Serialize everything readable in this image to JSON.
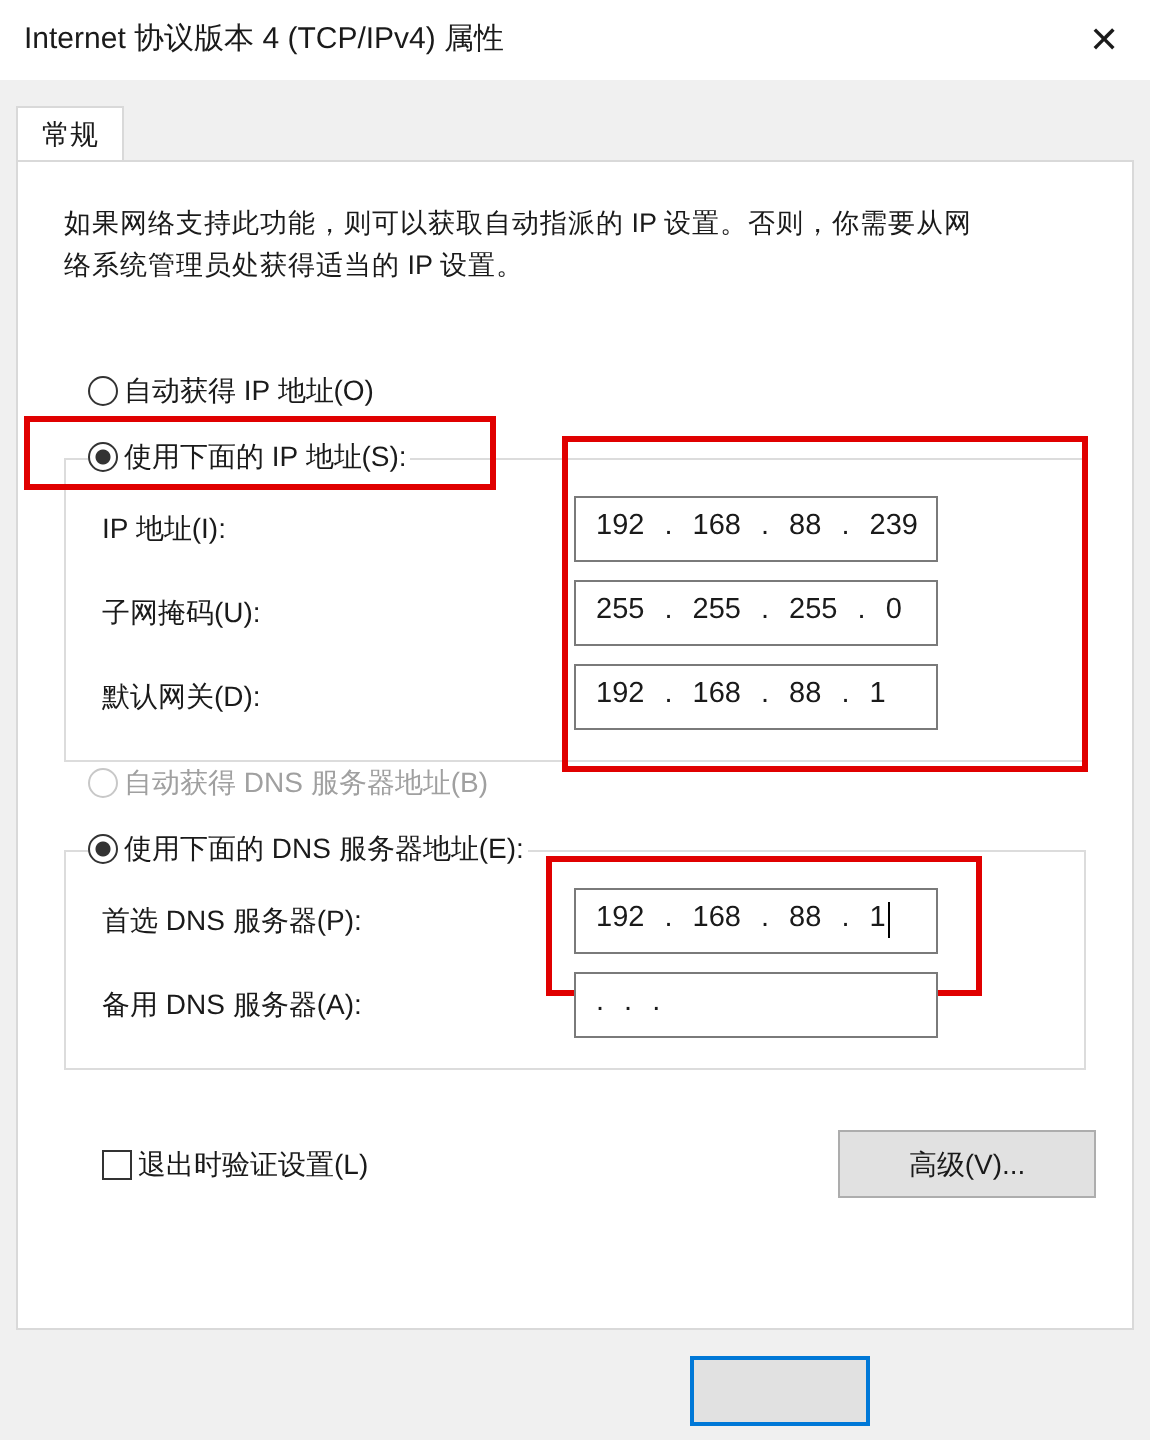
{
  "window": {
    "title": "Internet 协议版本 4 (TCP/IPv4) 属性",
    "close": "✕"
  },
  "tabs": [
    {
      "label": "常规",
      "selected": true
    }
  ],
  "description": "如果网络支持此功能，则可以获取自动指派的 IP 设置。否则，你需要从网络系统管理员处获得适当的 IP 设置。",
  "ip_options": [
    {
      "label": "自动获得 IP 地址(O)",
      "selected": false,
      "disabled": false
    },
    {
      "label": "使用下面的 IP 地址(S):",
      "selected": true,
      "disabled": false,
      "highlighted": true
    }
  ],
  "ip_fields": {
    "highlighted": true,
    "rows": [
      {
        "label": "IP 地址(I):",
        "value": "192 . 168 . 88 . 239"
      },
      {
        "label": "子网掩码(U):",
        "value": "255 . 255 . 255 . 0"
      },
      {
        "label": "默认网关(D):",
        "value": "192 . 168 . 88 . 1"
      }
    ]
  },
  "dns_options": [
    {
      "label": "自动获得 DNS 服务器地址(B)",
      "selected": false,
      "disabled": true
    },
    {
      "label": "使用下面的 DNS 服务器地址(E):",
      "selected": true,
      "disabled": false
    }
  ],
  "dns_fields": {
    "rows": [
      {
        "label": "首选 DNS 服务器(P):",
        "value": "192 . 168 . 88 . 1",
        "focused": true,
        "highlighted": true
      },
      {
        "label": "备用 DNS 服务器(A):",
        "value": ". . ."
      }
    ]
  },
  "validate_on_exit": {
    "label": "退出时验证设置(L)",
    "checked": false
  },
  "advanced_button": "高级(V)..."
}
